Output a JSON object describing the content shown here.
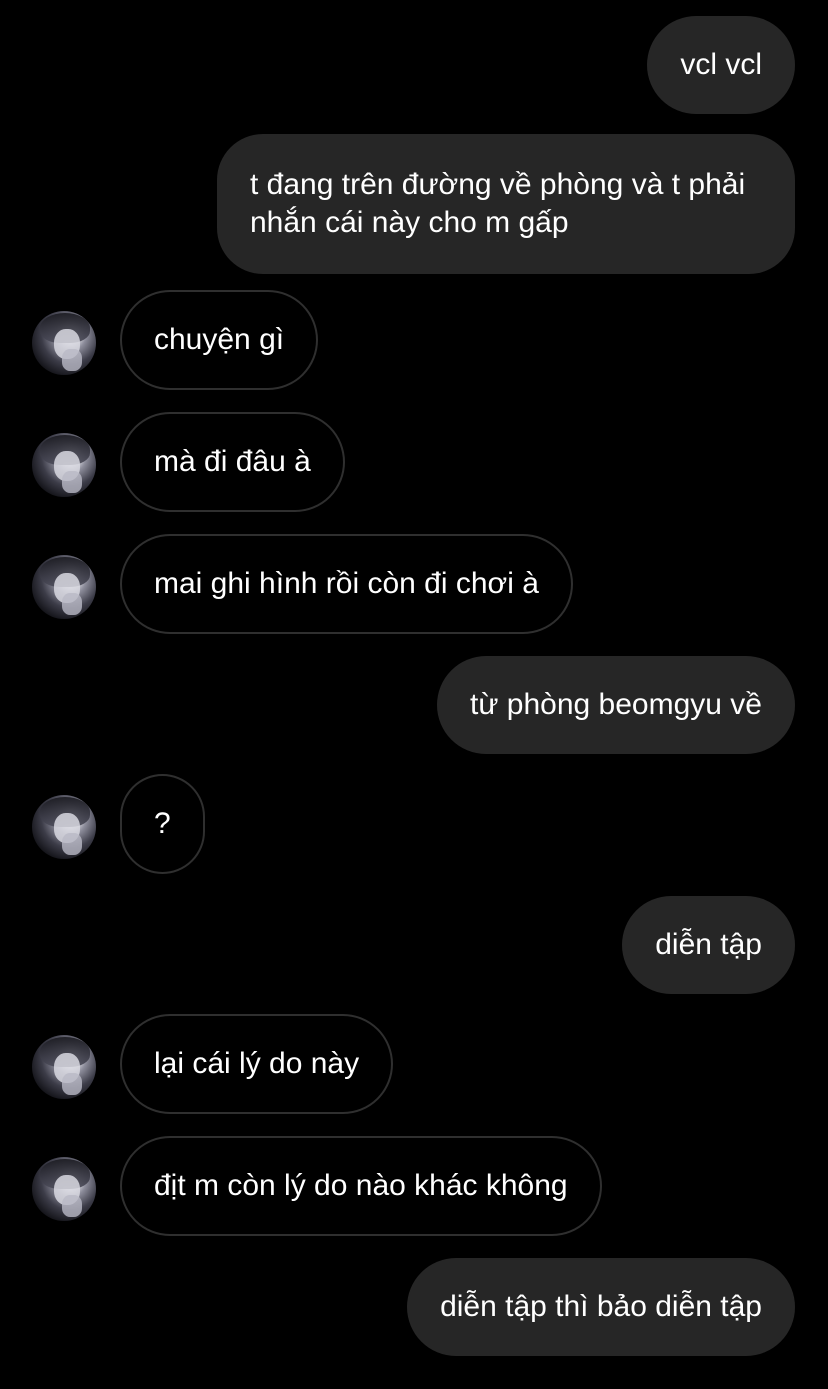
{
  "conversation": {
    "messages": [
      {
        "sender": "me",
        "text": "vcl vcl"
      },
      {
        "sender": "me",
        "text": "t đang trên đường về phòng và t phải nhắn cái này cho m gấp"
      },
      {
        "sender": "them",
        "text": "chuyện gì"
      },
      {
        "sender": "them",
        "text": "mà đi đâu à"
      },
      {
        "sender": "them",
        "text": "mai ghi hình rồi còn đi chơi à"
      },
      {
        "sender": "me",
        "text": "từ phòng beomgyu về"
      },
      {
        "sender": "them",
        "text": "?"
      },
      {
        "sender": "me",
        "text": "diễn tập"
      },
      {
        "sender": "them",
        "text": "lại cái lý do này"
      },
      {
        "sender": "them",
        "text": "địt m còn lý do nào khác không"
      },
      {
        "sender": "me",
        "text": "diễn tập thì bảo diễn tập"
      }
    ]
  },
  "colors": {
    "background": "#000000",
    "sent_bubble": "#262626",
    "received_bubble_border": "#2f2f2f",
    "text": "#ffffff"
  }
}
